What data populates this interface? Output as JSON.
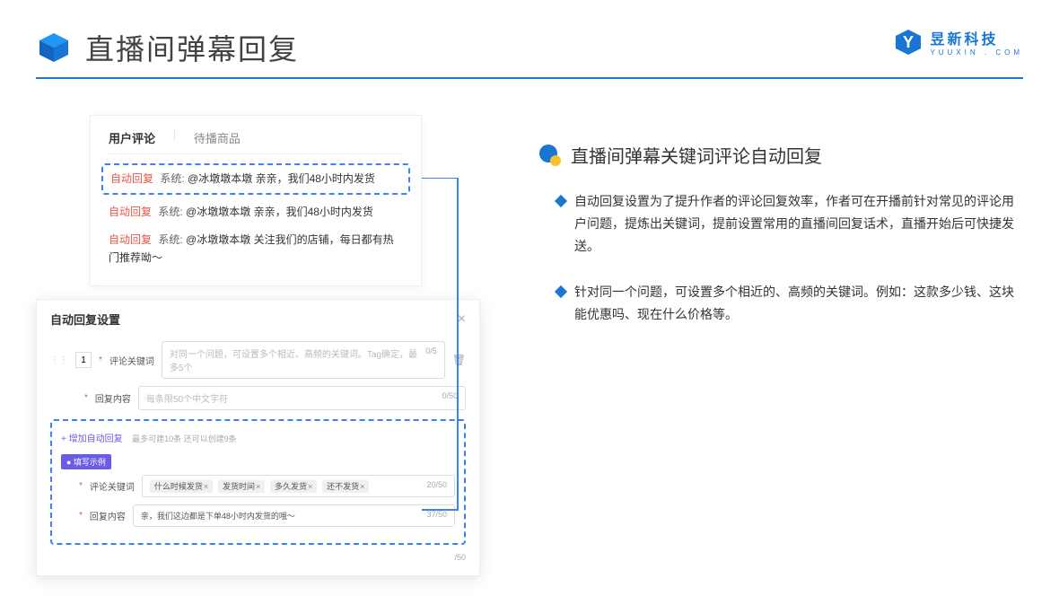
{
  "header": {
    "title": "直播间弹幕回复",
    "brand_cn": "昱新科技",
    "brand_en": "YUUXIN . COM"
  },
  "card1": {
    "tabs": {
      "active": "用户评论",
      "inactive": "待播商品"
    },
    "comments": [
      {
        "tag": "自动回复",
        "sys": "系统:",
        "text": "@冰墩墩本墩 亲亲，我们48小时内发货"
      },
      {
        "tag": "自动回复",
        "sys": "系统:",
        "text": "@冰墩墩本墩 亲亲，我们48小时内发货"
      },
      {
        "tag": "自动回复",
        "sys": "系统:",
        "text": "@冰墩墩本墩 关注我们的店铺，每日都有热门推荐呦～"
      }
    ]
  },
  "card2": {
    "title": "自动回复设置",
    "row_num": "1",
    "field1_label": "评论关键词",
    "field1_placeholder": "对同一个问题，可设置多个相近、高频的关键词。Tag确定，最多5个",
    "field1_counter": "0/5",
    "field2_label": "回复内容",
    "field2_placeholder": "每条限50个中文字符",
    "field2_counter": "0/50",
    "add_link": "+ 增加自动回复",
    "add_hint": "最多可建10条 还可以创建9条",
    "example_badge": "● 填写示例",
    "ex_field1_label": "评论关键词",
    "ex_tags": [
      "什么时候发货",
      "发货时间",
      "多久发货",
      "还不发货"
    ],
    "ex_counter1": "20/50",
    "ex_field2_label": "回复内容",
    "ex_field2_text": "亲，我们这边都是下单48小时内发货的哦～",
    "ex_counter2": "37/50",
    "ex_counter3": "/50"
  },
  "right": {
    "section_title": "直播间弹幕关键词评论自动回复",
    "bullets": [
      "自动回复设置为了提升作者的评论回复效率，作者可在开播前针对常见的评论用户问题，提炼出关键词，提前设置常用的直播间回复话术，直播开始后可快捷发送。",
      "针对同一个问题，可设置多个相近的、高频的关键词。例如：这款多少钱、这块能优惠吗、现在什么价格等。"
    ]
  }
}
